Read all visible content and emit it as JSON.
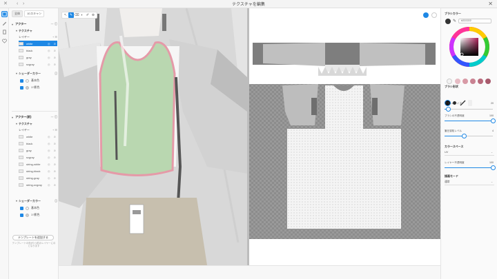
{
  "window": {
    "title": "テクスチャを編集",
    "close_glyph": "✕"
  },
  "titlebar_controls": [
    "‹",
    "›"
  ],
  "layers_panel": {
    "tabs": [
      "全体",
      "1Dスキャン"
    ],
    "actor1": {
      "title": "アクター",
      "texture_title": "テクスチャ",
      "layer_label": "レイヤー",
      "layers": [
        {
          "name": "white",
          "selected": true
        },
        {
          "name": "black",
          "selected": false
        },
        {
          "name": "gray",
          "selected": false
        },
        {
          "name": "svgray",
          "selected": false
        }
      ],
      "shader_title": "シェーダーカラー",
      "shader_items": [
        "基本色",
        "1?影色"
      ]
    },
    "actor2": {
      "title": "アクター(前)",
      "texture_title": "テクスチャ",
      "layer_label": "レイヤー",
      "layers": [
        {
          "name": "white"
        },
        {
          "name": "black"
        },
        {
          "name": "gray"
        },
        {
          "name": "svgray"
        },
        {
          "name": "string-white"
        },
        {
          "name": "string-black"
        },
        {
          "name": "string-gray"
        },
        {
          "name": "string-svgray"
        }
      ],
      "shader_title": "シェーダーカラー",
      "shader_items": [
        "基本色",
        "1?影色"
      ]
    },
    "template_button": "テンプレートを追加する",
    "template_note": "テンプレートの色が1つ前のレイヤーにのとなります"
  },
  "viewport_tools": [
    "↖",
    "✎",
    "⌫",
    "◐",
    "✐",
    "⊕"
  ],
  "brush_panel": {
    "color_title": "ブラシカラー",
    "hex_value": "#222222",
    "presets": [
      "#f3f3f3",
      "#e6bcc4",
      "#d89aa6",
      "#c98292",
      "#b86a7c",
      "#a85a6c"
    ],
    "shape_title": "ブラシ形状",
    "brush_size_label": "ブラシのサイズ",
    "brush_size_value": "20",
    "brush_size_fraction": 0.08,
    "opacity_label": "ブラシの不透明度",
    "opacity_value": "100",
    "opacity_fraction": 1.0,
    "blur_label": "筆圧感知レベル",
    "blur_value": "4",
    "blur_fraction": 0.4,
    "space_title": "カラースペース",
    "space_value": "UV",
    "layer_opacity_label": "レイヤー不透明度",
    "layer_opacity_value": "100",
    "layer_opacity_fraction": 1.0,
    "blend_title": "描画モード",
    "blend_value": "通常"
  },
  "colors": {
    "accent": "#1e88e5",
    "selected_layer": "#1e88e5",
    "top_green": "#b9d7b0",
    "trim_pink": "#e59aa8"
  }
}
